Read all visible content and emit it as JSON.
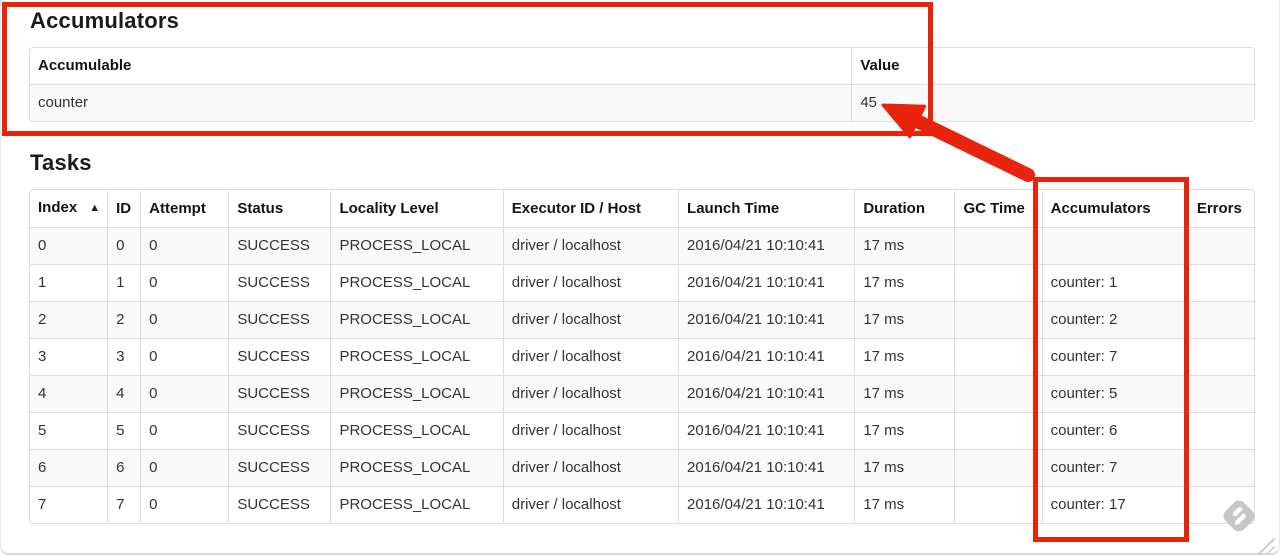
{
  "accumulators": {
    "title": "Accumulators",
    "headers": [
      "Accumulable",
      "Value"
    ],
    "rows": [
      [
        "counter",
        "45"
      ]
    ]
  },
  "tasks": {
    "title": "Tasks",
    "headers": [
      "Index",
      "ID",
      "Attempt",
      "Status",
      "Locality Level",
      "Executor ID / Host",
      "Launch Time",
      "Duration",
      "GC Time",
      "Accumulators",
      "Errors"
    ],
    "sort_icon": "▲",
    "sorted_column": "Index",
    "sort_direction": "ascending",
    "rows": [
      [
        "0",
        "0",
        "0",
        "SUCCESS",
        "PROCESS_LOCAL",
        "driver / localhost",
        "2016/04/21 10:10:41",
        "17 ms",
        "",
        "",
        ""
      ],
      [
        "1",
        "1",
        "0",
        "SUCCESS",
        "PROCESS_LOCAL",
        "driver / localhost",
        "2016/04/21 10:10:41",
        "17 ms",
        "",
        "counter: 1",
        ""
      ],
      [
        "2",
        "2",
        "0",
        "SUCCESS",
        "PROCESS_LOCAL",
        "driver / localhost",
        "2016/04/21 10:10:41",
        "17 ms",
        "",
        "counter: 2",
        ""
      ],
      [
        "3",
        "3",
        "0",
        "SUCCESS",
        "PROCESS_LOCAL",
        "driver / localhost",
        "2016/04/21 10:10:41",
        "17 ms",
        "",
        "counter: 7",
        ""
      ],
      [
        "4",
        "4",
        "0",
        "SUCCESS",
        "PROCESS_LOCAL",
        "driver / localhost",
        "2016/04/21 10:10:41",
        "17 ms",
        "",
        "counter: 5",
        ""
      ],
      [
        "5",
        "5",
        "0",
        "SUCCESS",
        "PROCESS_LOCAL",
        "driver / localhost",
        "2016/04/21 10:10:41",
        "17 ms",
        "",
        "counter: 6",
        ""
      ],
      [
        "6",
        "6",
        "0",
        "SUCCESS",
        "PROCESS_LOCAL",
        "driver / localhost",
        "2016/04/21 10:10:41",
        "17 ms",
        "",
        "counter: 7",
        ""
      ],
      [
        "7",
        "7",
        "0",
        "SUCCESS",
        "PROCESS_LOCAL",
        "driver / localhost",
        "2016/04/21 10:10:41",
        "17 ms",
        "",
        "counter: 17",
        ""
      ]
    ]
  },
  "annotations": {
    "color": "#e8240c"
  }
}
